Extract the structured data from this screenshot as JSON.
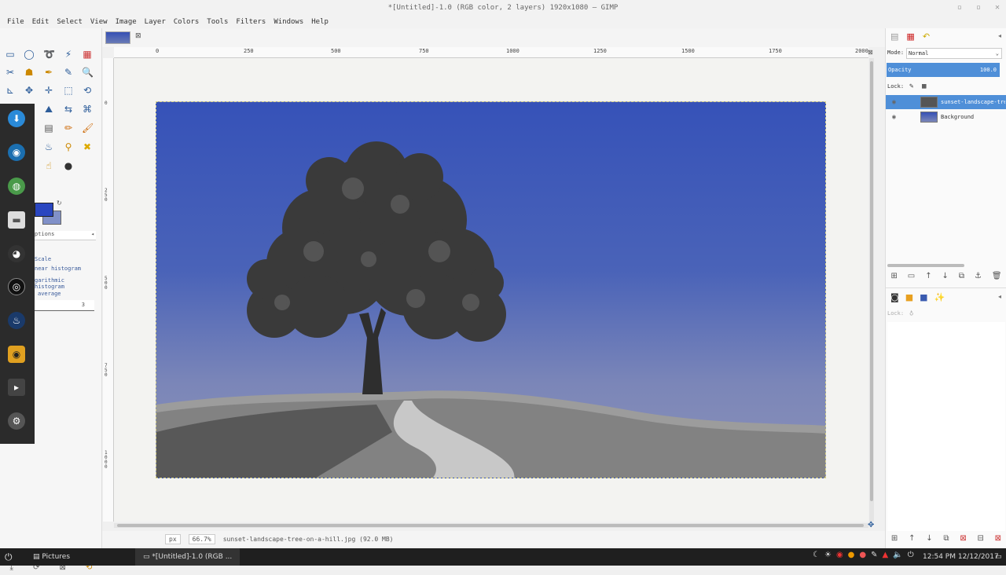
{
  "window": {
    "title": "*[Untitled]-1.0 (RGB color, 2 layers) 1920x1080 – GIMP",
    "controls": [
      "▫",
      "▫",
      "✕"
    ]
  },
  "menu": [
    "File",
    "Edit",
    "Select",
    "View",
    "Image",
    "Layer",
    "Colors",
    "Tools",
    "Filters",
    "Windows",
    "Help"
  ],
  "image_tab": {
    "close": "⊠"
  },
  "ruler": {
    "h_ticks": [
      "0",
      "250",
      "500",
      "750",
      "1000",
      "1250",
      "1500",
      "1750",
      "2000"
    ],
    "v_ticks": [
      "0",
      "250",
      "500",
      "750",
      "1000"
    ]
  },
  "tool_options": {
    "title": "ptions",
    "items": [
      "Scale",
      "near histogram",
      "garithmic histogram",
      "average"
    ],
    "spinner_value": "3"
  },
  "status": {
    "unit": "px",
    "zoom": "66.7%",
    "file": "sunset-landscape-tree-on-a-hill.jpg (92.0 MB)"
  },
  "layers": {
    "mode_label": "Mode:",
    "mode_value": "Normal",
    "opacity_label": "Opacity",
    "opacity_value": "100.0",
    "lock_label": "Lock:",
    "items": [
      {
        "name": "sunset-landscape-tree-on-a-hill.jpg",
        "selected": true
      },
      {
        "name": "Background",
        "selected": false
      }
    ]
  },
  "channels": {
    "lock_label": "Lock:"
  },
  "taskbar": {
    "app1": "Pictures",
    "app2": "*[Untitled]-1.0 (RGB ...",
    "clock": "12:54 PM 12/12/2017"
  },
  "colors": {
    "fg": "#2a46c0",
    "bg": "#8090c8",
    "selection": "#4f8fd8"
  }
}
